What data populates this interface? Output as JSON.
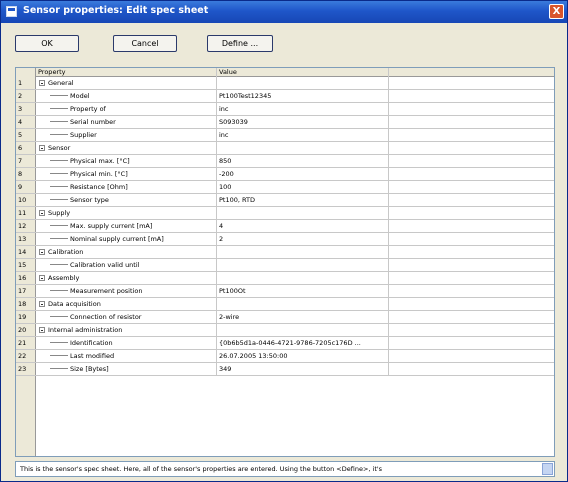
{
  "window": {
    "title": "Sensor properties: Edit spec sheet",
    "close_label": "X"
  },
  "buttons": {
    "ok": "OK",
    "cancel": "Cancel",
    "define": "Define ..."
  },
  "grid": {
    "headers": {
      "property": "Property",
      "value": "Value"
    },
    "rows": [
      {
        "num": "1",
        "property": "General",
        "value": "",
        "group": true
      },
      {
        "num": "2",
        "property": "Model",
        "value": "Pt100Test12345",
        "group": false
      },
      {
        "num": "3",
        "property": "Property of",
        "value": "inc",
        "group": false
      },
      {
        "num": "4",
        "property": "Serial number",
        "value": "S093039",
        "group": false
      },
      {
        "num": "5",
        "property": "Supplier",
        "value": "inc",
        "group": false
      },
      {
        "num": "6",
        "property": "Sensor",
        "value": "",
        "group": true
      },
      {
        "num": "7",
        "property": "Physical max. [°C]",
        "value": "850",
        "group": false
      },
      {
        "num": "8",
        "property": "Physical min. [°C]",
        "value": "-200",
        "group": false
      },
      {
        "num": "9",
        "property": "Resistance [Ohm]",
        "value": "100",
        "group": false
      },
      {
        "num": "10",
        "property": "Sensor type",
        "value": "Pt100, RTD",
        "group": false
      },
      {
        "num": "11",
        "property": "Supply",
        "value": "",
        "group": true
      },
      {
        "num": "12",
        "property": "Max. supply current [mA]",
        "value": "4",
        "group": false
      },
      {
        "num": "13",
        "property": "Nominal supply current [mA]",
        "value": "2",
        "group": false
      },
      {
        "num": "14",
        "property": "Calibration",
        "value": "",
        "group": true
      },
      {
        "num": "15",
        "property": "Calibration valid until",
        "value": "",
        "group": false
      },
      {
        "num": "16",
        "property": "Assembly",
        "value": "",
        "group": true
      },
      {
        "num": "17",
        "property": "Measurement position",
        "value": "Pt100Ot",
        "group": false
      },
      {
        "num": "18",
        "property": "Data acquisition",
        "value": "",
        "group": true
      },
      {
        "num": "19",
        "property": "Connection of resistor",
        "value": "2-wire",
        "group": false
      },
      {
        "num": "20",
        "property": "Internal administration",
        "value": "",
        "group": true
      },
      {
        "num": "21",
        "property": "Identification",
        "value": "{0b6b5d1a-0446-4721-9786-7205c176D ...",
        "group": false
      },
      {
        "num": "22",
        "property": "Last modified",
        "value": "26.07.2005 13:50:00",
        "group": false
      },
      {
        "num": "23",
        "property": "Size [Bytes]",
        "value": "349",
        "group": false
      }
    ]
  },
  "status": {
    "text": "This is the sensor's spec sheet. Here, all of the sensor's properties are entered. Using the button <Define>, it's"
  },
  "colors": {
    "titlebar": "#1f56c9",
    "close": "#d9552c",
    "frame": "#ece9d8"
  },
  "icons": {
    "title": "window-app-icon",
    "close": "close-icon",
    "group": "collapse-minus-icon"
  }
}
